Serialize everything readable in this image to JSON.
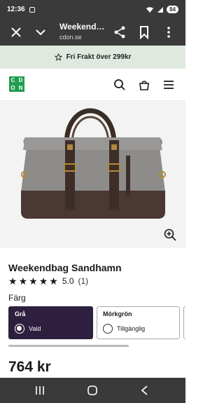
{
  "status_bar": {
    "time": "12:36",
    "battery": "84"
  },
  "browser": {
    "title": "Weekend…",
    "url": "cdon.se"
  },
  "promo": {
    "text": "Fri Frakt över 299kr"
  },
  "logo": {
    "letters": [
      "C",
      "D",
      "O",
      "N"
    ],
    "colors": [
      "#1f9d4e",
      "#1f9d4e",
      "#1f9d4e",
      "#1f9d4e"
    ]
  },
  "product": {
    "name": "Weekendbag Sandhamn",
    "rating": "5.0",
    "review_count": "(1)",
    "color_label": "Färg",
    "options": [
      {
        "name": "Grå",
        "status": "Vald",
        "selected": true
      },
      {
        "name": "Mörkgrön",
        "status": "Tillgänglig",
        "selected": false
      }
    ],
    "price": "764 kr"
  },
  "colors": {
    "selected_option_bg": "#2d1f3d",
    "promo_bg": "#dfe9df",
    "chrome": "#3a3a3a"
  },
  "icons": [
    "close-icon",
    "chevron-down-icon",
    "share-icon",
    "bookmark-icon",
    "more-icon",
    "star-outline-icon",
    "search-icon",
    "cart-icon",
    "menu-icon",
    "zoom-in-icon",
    "recent-apps-icon",
    "home-icon",
    "back-icon"
  ]
}
